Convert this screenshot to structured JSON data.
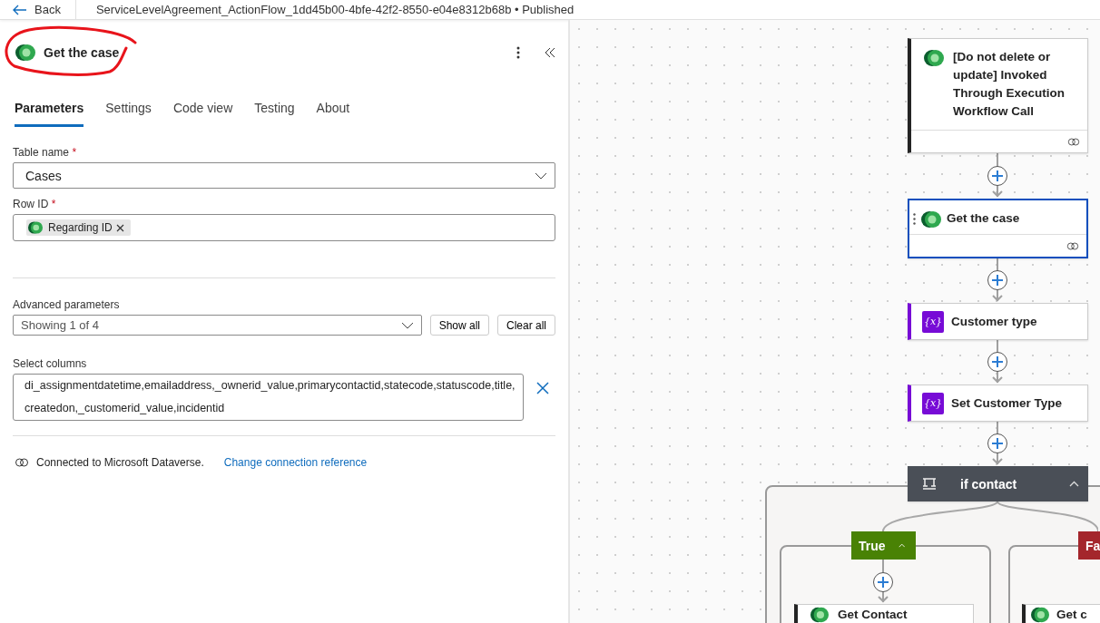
{
  "top_bar": {
    "back": "Back",
    "title": "ServiceLevelAgreement_ActionFlow_1dd45b00-4bfe-42f2-8550-e04e8312b68b • Published"
  },
  "panel": {
    "title": "Get the case",
    "tabs": [
      {
        "label": "Parameters",
        "selected": true
      },
      {
        "label": "Settings",
        "selected": false
      },
      {
        "label": "Code view",
        "selected": false
      },
      {
        "label": "Testing",
        "selected": false
      },
      {
        "label": "About",
        "selected": false
      }
    ],
    "table_name": {
      "label": "Table name",
      "required_mark": "*",
      "value": "Cases"
    },
    "row_id": {
      "label": "Row ID",
      "required_mark": "*",
      "token": "Regarding ID"
    },
    "advanced": {
      "label": "Advanced parameters",
      "value": "Showing 1 of 4",
      "buttons": [
        "Show all",
        "Clear all"
      ]
    },
    "select_columns": {
      "label": "Select columns",
      "value": "di_assignmentdatetime,emailaddress,_ownerid_value,primarycontactid,statecode,statuscode,title,createdon,_customerid_value,incidentid"
    },
    "connection": {
      "text": "Connected to Microsoft Dataverse.",
      "link": "Change connection reference"
    }
  },
  "flow": {
    "nodes": [
      {
        "kind": "dataverse",
        "title": "[Do not delete or update] Invoked Through Execution Workflow Call",
        "selected": false
      },
      {
        "kind": "dataverse",
        "title": "Get the case",
        "selected": true
      },
      {
        "kind": "variable",
        "icon": "{x}",
        "title": "Customer type",
        "selected": false
      },
      {
        "kind": "variable",
        "icon": "{x}",
        "title": "Set Customer Type",
        "selected": false
      },
      {
        "kind": "condition",
        "title": "if contact"
      }
    ],
    "branches": [
      {
        "label": "True",
        "color": "#498205",
        "card": "Get Contact"
      },
      {
        "label": "Fa",
        "color": "#a4262c",
        "card": "Get c"
      }
    ]
  }
}
